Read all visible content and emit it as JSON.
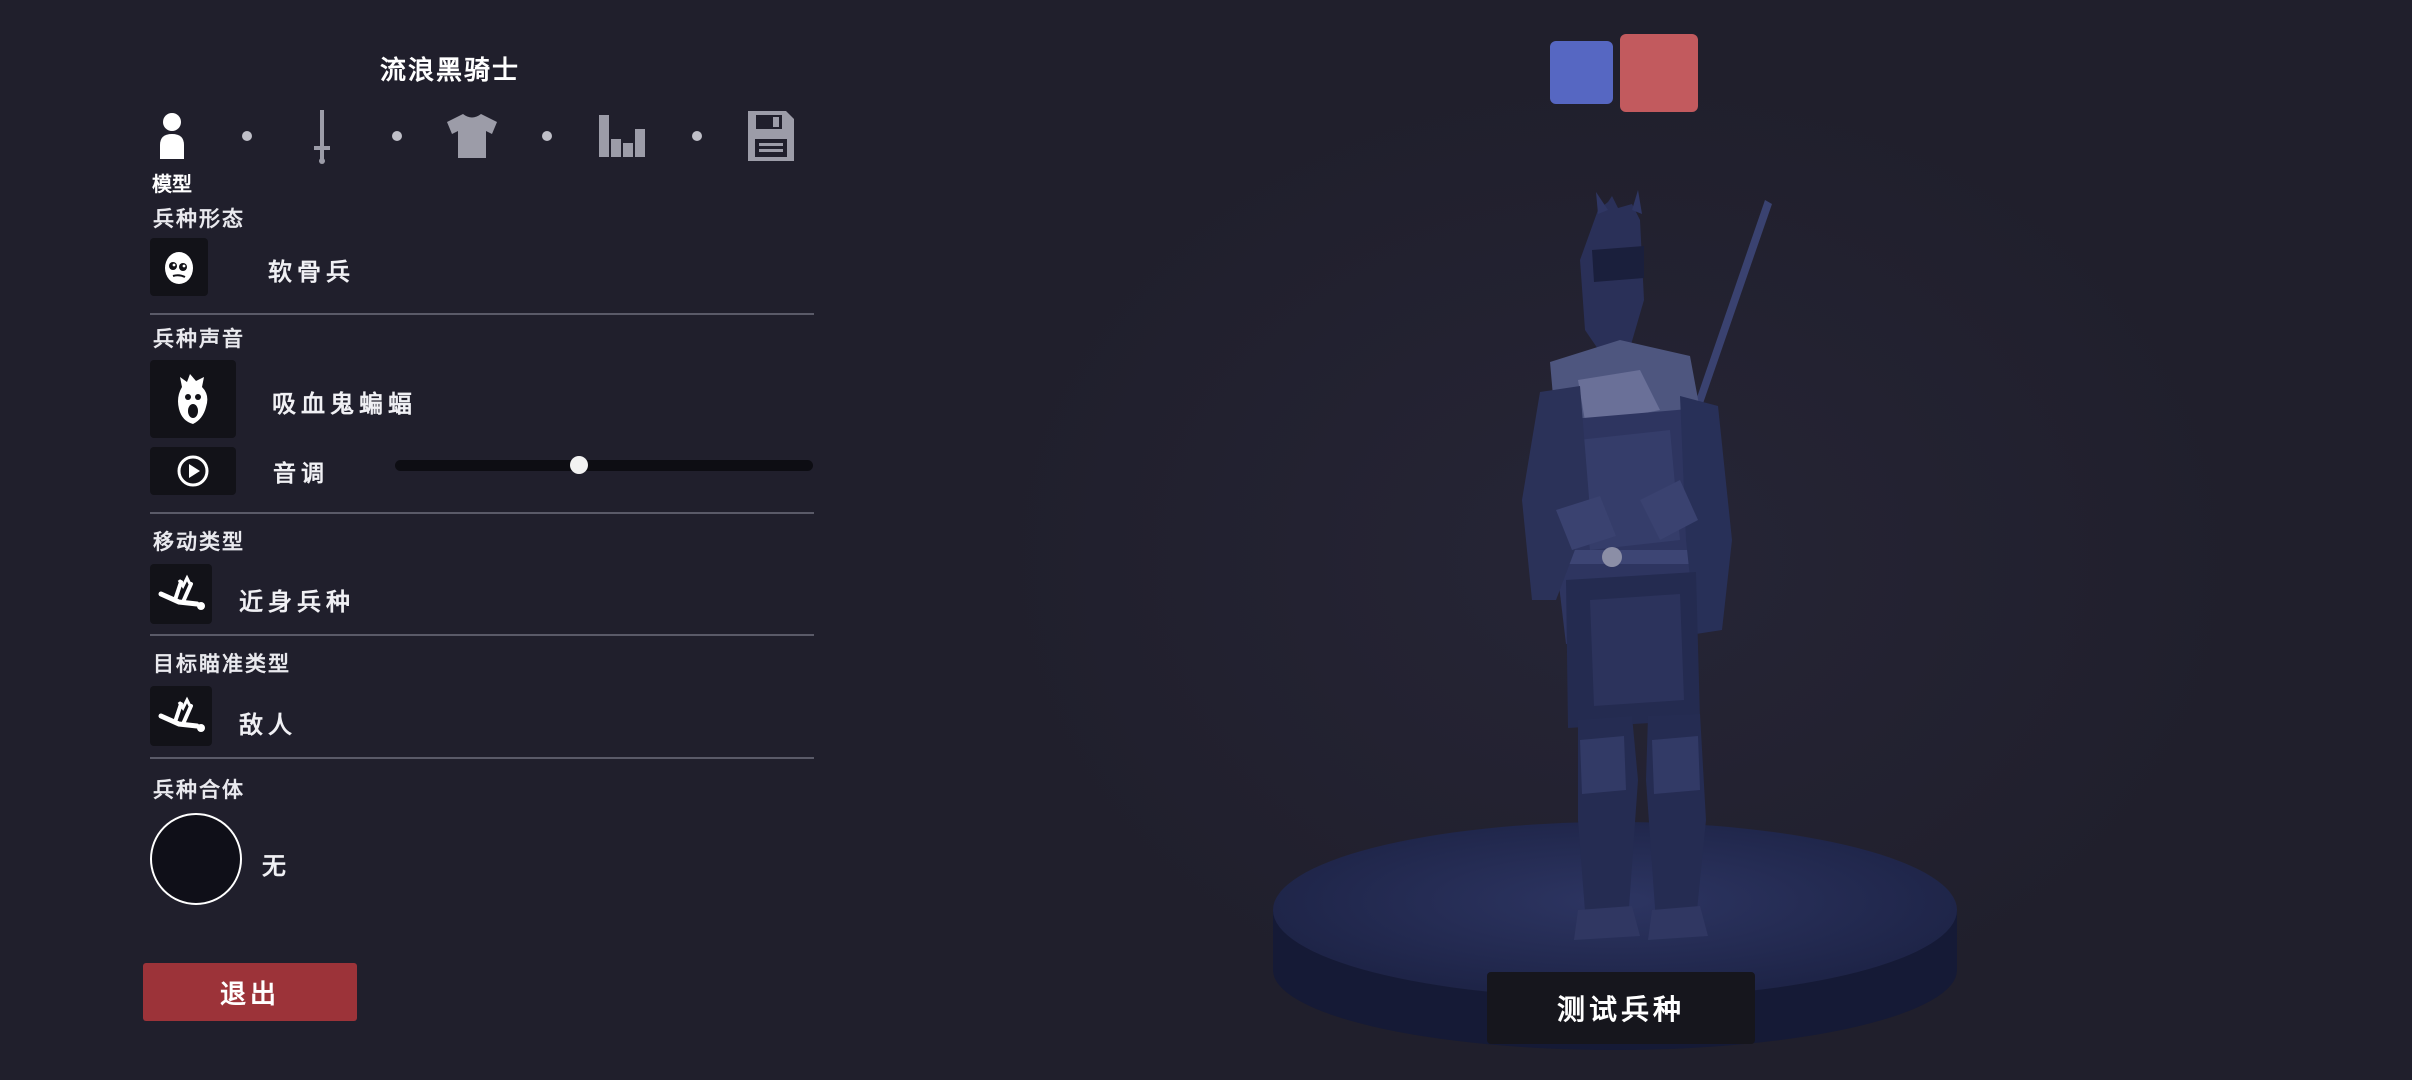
{
  "unit_name": "流浪黑骑士",
  "steps": [
    {
      "icon": "person-icon",
      "label": "模型",
      "active": true
    },
    {
      "icon": "sword-icon",
      "active": false
    },
    {
      "icon": "shirt-icon",
      "active": false
    },
    {
      "icon": "stats-icon",
      "active": false
    },
    {
      "icon": "save-icon",
      "active": false
    }
  ],
  "sections": {
    "form": {
      "label": "兵种形态",
      "value": "软骨兵"
    },
    "voice": {
      "label": "兵种声音",
      "value": "吸血鬼蝙蝠",
      "pitch_label": "音调",
      "pitch_value": 0.44
    },
    "movement": {
      "label": "移动类型",
      "value": "近身兵种"
    },
    "targeting": {
      "label": "目标瞄准类型",
      "value": "敌人"
    },
    "merge": {
      "label": "兵种合体",
      "value": "无"
    }
  },
  "buttons": {
    "exit": "退出",
    "test": "测试兵种"
  },
  "teams": {
    "blue": "#5667c2",
    "red": "#c25a5e",
    "selected": "red"
  },
  "colors": {
    "background": "#201f2c",
    "exit_button": "#9c3339",
    "unit_tint": "#2e3560"
  }
}
